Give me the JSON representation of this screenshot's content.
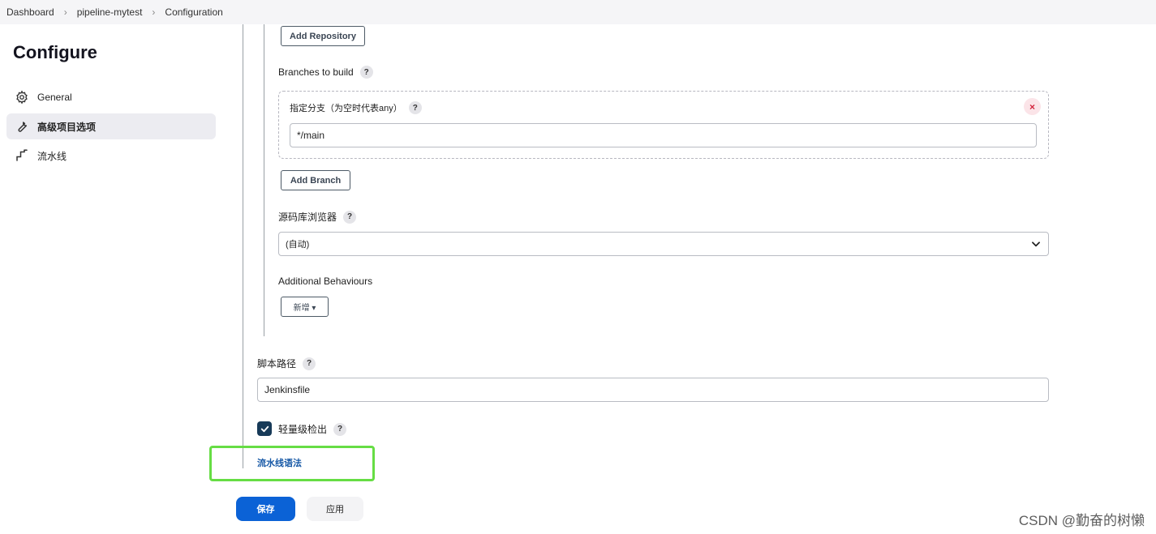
{
  "breadcrumb": {
    "items": [
      "Dashboard",
      "pipeline-mytest",
      "Configuration"
    ]
  },
  "page_title": "Configure",
  "sidebar": {
    "items": [
      {
        "label": "General",
        "icon": "gear-icon",
        "active": false
      },
      {
        "label": "高级项目选项",
        "icon": "wrench-icon",
        "active": true
      },
      {
        "label": "流水线",
        "icon": "pipeline-icon",
        "active": false
      }
    ]
  },
  "scm": {
    "add_repository_label": "Add Repository",
    "branches_label": "Branches to build",
    "branch_specifier_label": "指定分支（为空时代表any）",
    "branch_specifier_value": "*/main",
    "remove_label": "×",
    "add_branch_label": "Add Branch",
    "repo_browser_label": "源码库浏览器",
    "repo_browser_value": "(自动)",
    "additional_behaviours_label": "Additional Behaviours",
    "add_behaviour_label": "新增 ▾"
  },
  "script_path": {
    "label": "脚本路径",
    "value": "Jenkinsfile"
  },
  "lightweight_checkout": {
    "label": "轻量级检出",
    "checked": true
  },
  "pipeline_syntax_link": "流水线语法",
  "actions": {
    "save_label": "保存",
    "apply_label": "应用"
  },
  "help_glyph": "?",
  "watermark": "CSDN @勤奋的树懒",
  "colors": {
    "primary": "#0b62d6",
    "checkbox": "#173a58",
    "link": "#1658a6",
    "highlight": "#66dd44",
    "remove": "#d3243c"
  }
}
